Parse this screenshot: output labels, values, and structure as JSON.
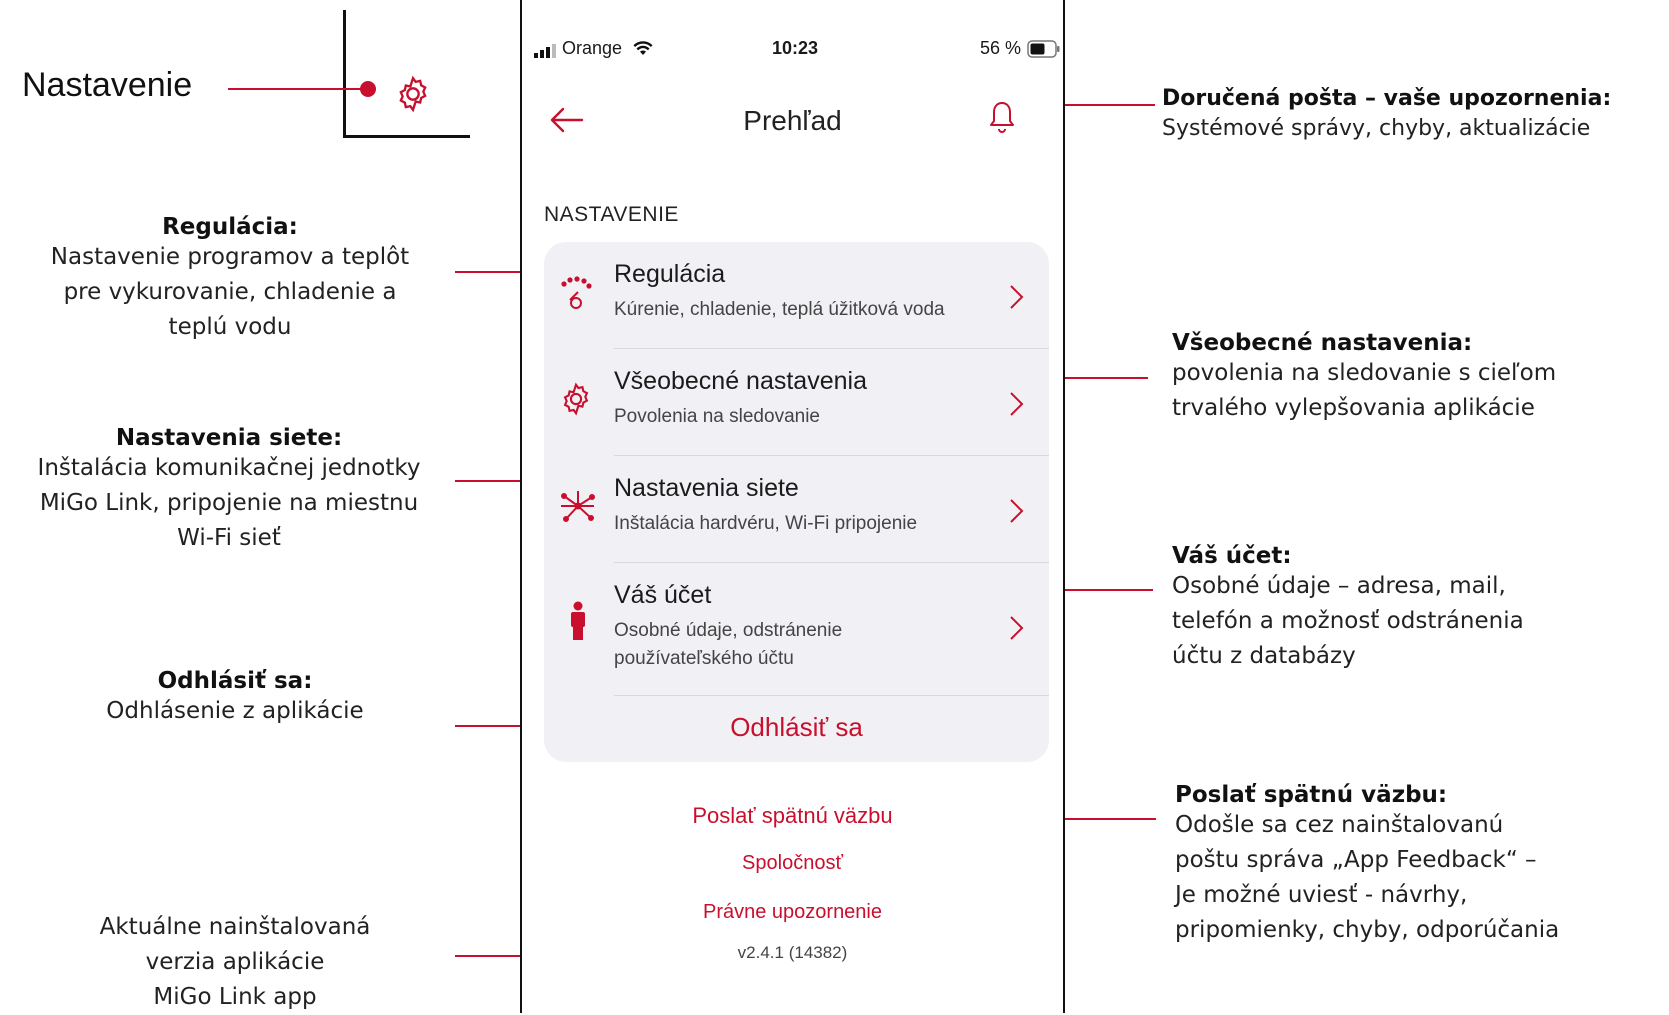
{
  "annotations": {
    "nastavenie_label": "Nastavenie",
    "regulacia": {
      "title": "Regulácia:",
      "lines": [
        "Nastavenie programov a teplôt",
        "pre vykurovanie, chladenie a",
        "teplú vodu"
      ]
    },
    "siete": {
      "title": "Nastavenia siete:",
      "lines": [
        "Inštalácia komunikačnej jednotky",
        "MiGo Link, pripojenie na miestnu",
        "Wi-Fi sieť"
      ]
    },
    "odhlasit": {
      "title": "Odhlásiť sa:",
      "lines": [
        "Odhlásenie z aplikácie"
      ]
    },
    "verzia": {
      "lines": [
        "Aktuálne nainštalovaná",
        "verzia aplikácie",
        "MiGo Link app"
      ]
    },
    "posta": {
      "title": "Doručená pošta – vaše upozornenia:",
      "lines": [
        "Systémové správy, chyby, aktualizácie"
      ]
    },
    "vseobecne": {
      "title": "Všeobecné nastavenia:",
      "lines": [
        "povolenia na sledovanie s cieľom",
        "trvalého vylepšovania aplikácie"
      ]
    },
    "ucet": {
      "title": "Váš účet:",
      "lines": [
        "Osobné údaje – adresa, mail,",
        "telefón a možnosť odstránenia",
        "účtu z databázy"
      ]
    },
    "spatna": {
      "title": "Poslať spätnú väzbu:",
      "lines": [
        "Odošle sa cez nainštalovanú",
        "poštu správa „App Feedback“ –",
        "Je možné uviesť - návrhy,",
        "pripomienky, chyby, odporúčania"
      ]
    }
  },
  "phone": {
    "status": {
      "carrier": "Orange",
      "time": "10:23",
      "battery": "56 %"
    },
    "header_title": "Prehľad",
    "section_label": "NASTAVENIE",
    "rows": [
      {
        "title": "Regulácia",
        "subtitle": "Kúrenie, chladenie, teplá úžitková voda",
        "icon": "regulation-icon"
      },
      {
        "title": "Všeobecné nastavenia",
        "subtitle": "Povolenia na sledovanie",
        "icon": "gear-icon"
      },
      {
        "title": "Nastavenia siete",
        "subtitle": "Inštalácia hardvéru, Wi-Fi pripojenie",
        "icon": "network-icon"
      },
      {
        "title": "Váš účet",
        "subtitle": "Osobné údaje, odstránenie používateľského účtu",
        "icon": "person-icon"
      }
    ],
    "logout": "Odhlásiť sa",
    "feedback": "Poslať spätnú väzbu",
    "company": "Spoločnosť",
    "legal": "Právne upozornenie",
    "version": "v2.4.1 (14382)"
  },
  "colors": {
    "accent": "#c8102e",
    "card_bg": "#f1f0f4"
  }
}
